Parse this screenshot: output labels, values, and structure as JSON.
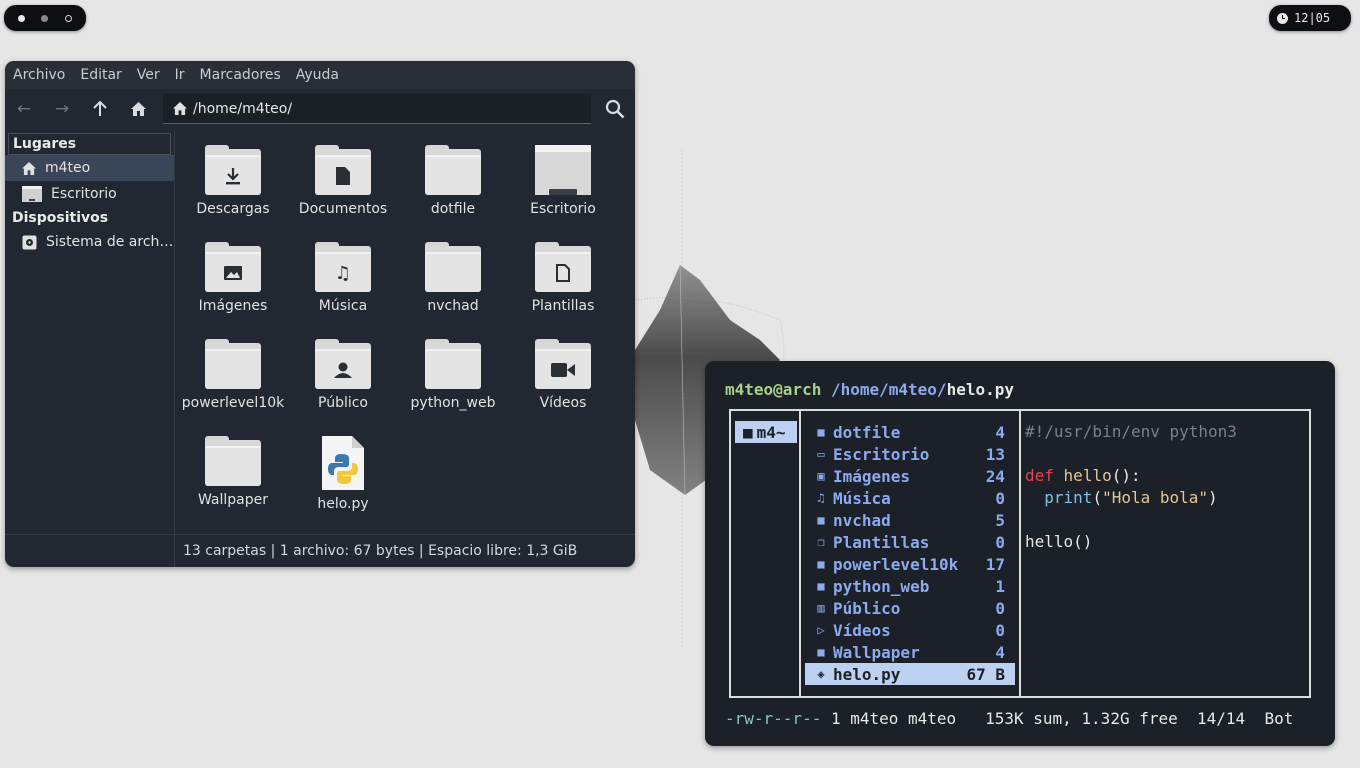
{
  "bar": {
    "workspaces": [
      "active",
      "busy",
      "empty"
    ],
    "clock": "12|05"
  },
  "file_manager": {
    "menu": [
      "Archivo",
      "Editar",
      "Ver",
      "Ir",
      "Marcadores",
      "Ayuda"
    ],
    "toolbar": {
      "back_icon": "arrow-left-icon",
      "forward_icon": "arrow-right-icon",
      "up_icon": "arrow-up-icon",
      "home_icon": "home-icon"
    },
    "location": "/home/m4teo/",
    "sidebar": {
      "places_header": "Lugares",
      "places": [
        {
          "label": "m4teo",
          "icon": "home-icon",
          "selected": true
        },
        {
          "label": "Escritorio",
          "icon": "desktop-icon",
          "selected": false
        }
      ],
      "devices_header": "Dispositivos",
      "devices": [
        {
          "label": "Sistema de arch…",
          "icon": "disk-icon"
        }
      ]
    },
    "files": [
      {
        "label": "Descargas",
        "icon": "download-icon"
      },
      {
        "label": "Documentos",
        "icon": "document-icon"
      },
      {
        "label": "dotfile",
        "icon": ""
      },
      {
        "label": "Escritorio",
        "icon": "desktop-icon"
      },
      {
        "label": "Imágenes",
        "icon": "image-icon"
      },
      {
        "label": "Música",
        "icon": "music-icon"
      },
      {
        "label": "nvchad",
        "icon": ""
      },
      {
        "label": "Plantillas",
        "icon": "template-icon"
      },
      {
        "label": "powerlevel10k",
        "icon": ""
      },
      {
        "label": "Público",
        "icon": "user-icon"
      },
      {
        "label": "python_web",
        "icon": ""
      },
      {
        "label": "Vídeos",
        "icon": "video-icon"
      },
      {
        "label": "Wallpaper",
        "icon": ""
      },
      {
        "label": "helo.py",
        "icon": "python-icon"
      }
    ],
    "status": "13 carpetas  |  1 archivo: 67 bytes  |  Espacio libre: 1,3 GiB"
  },
  "terminal": {
    "prompt_user": "m4teo@arch",
    "prompt_dir": "/home/m4teo/",
    "prompt_file": "helo.py",
    "parent_entry": "m4~",
    "entries": [
      {
        "name": "dotfile",
        "count": "4",
        "icon": "folder-icon"
      },
      {
        "name": "Escritorio",
        "count": "13",
        "icon": "monitor-icon"
      },
      {
        "name": "Imágenes",
        "count": "24",
        "icon": "image-icon"
      },
      {
        "name": "Música",
        "count": "0",
        "icon": "headphones-icon"
      },
      {
        "name": "nvchad",
        "count": "5",
        "icon": "folder-icon"
      },
      {
        "name": "Plantillas",
        "count": "0",
        "icon": "copy-icon"
      },
      {
        "name": "powerlevel10k",
        "count": "17",
        "icon": "folder-icon"
      },
      {
        "name": "python_web",
        "count": "1",
        "icon": "folder-icon"
      },
      {
        "name": "Público",
        "count": "0",
        "icon": "building-icon"
      },
      {
        "name": "Vídeos",
        "count": "0",
        "icon": "video-icon"
      },
      {
        "name": "Wallpaper",
        "count": "4",
        "icon": "folder-icon"
      },
      {
        "name": "helo.py",
        "count": "67 B",
        "icon": "python-icon",
        "selected": true
      }
    ],
    "preview": {
      "shebang": "#!/usr/bin/env python3",
      "def_kw": "def",
      "fn_name": "hello",
      "fn_sig": "():",
      "print_fn": "print",
      "print_open": "(",
      "print_str": "\"Hola bola\"",
      "print_close": ")",
      "call": "hello()"
    },
    "statusline": {
      "perms": "-rw-r--r--",
      "info": " 1 m4teo m4teo   153K sum, 1.32G free  14/14  Bot"
    }
  }
}
